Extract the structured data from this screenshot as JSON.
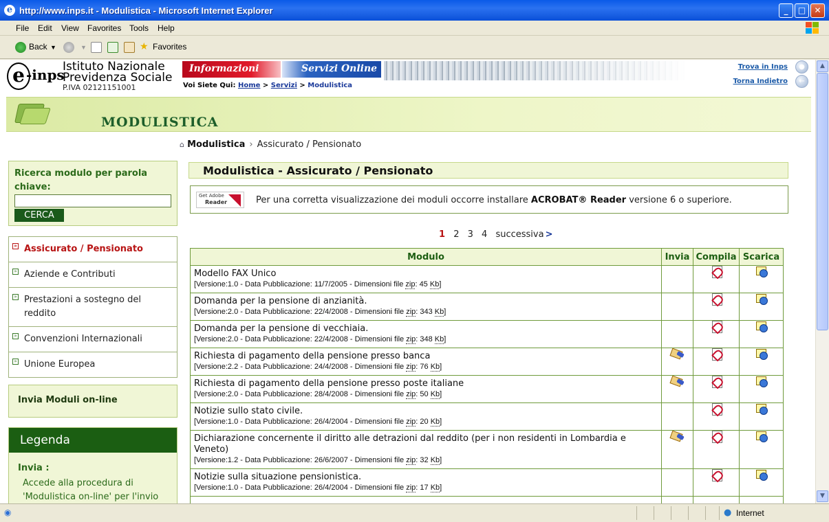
{
  "window": {
    "title": "http://www.inps.it - Modulistica - Microsoft Internet Explorer",
    "minimize": "_",
    "maximize": "□",
    "close": "✕"
  },
  "menu": [
    "File",
    "Edit",
    "View",
    "Favorites",
    "Tools",
    "Help"
  ],
  "toolbar": {
    "back_label": "Back",
    "favorites_label": "Favorites"
  },
  "status": {
    "zone": "Internet"
  },
  "header": {
    "logo_e": "e",
    "logo_inps": "-inps",
    "institute_line1": "Istituto Nazionale",
    "institute_line2": "Previdenza Sociale",
    "piva": "P.IVA 02121151001",
    "tab_informazioni": "Informazioni",
    "tab_servizi": "Servizi Online",
    "you_are_here": "Voi Siete Qui:",
    "crumb_home": "Home",
    "crumb_servizi": "Servizi",
    "crumb_current": "Modulistica",
    "crumb_sep": ">",
    "link_trova": "Trova in Inps",
    "link_torna": "Torna Indietro"
  },
  "banner": {
    "title": "MODULISTICA"
  },
  "page_crumb": {
    "root": "Modulistica",
    "sep": "›",
    "current": "Assicurato / Pensionato"
  },
  "search": {
    "label": "Ricerca modulo per parola chiave:",
    "value": "",
    "button": "CERCA"
  },
  "nav": {
    "items": [
      {
        "label": "Assicurato / Pensionato",
        "active": true
      },
      {
        "label": "Aziende e Contributi",
        "active": false
      },
      {
        "label": "Prestazioni a sostegno del reddito",
        "active": false
      },
      {
        "label": "Convenzioni Internazionali",
        "active": false
      },
      {
        "label": "Unione Europea",
        "active": false
      }
    ]
  },
  "invia_online": "Invia Moduli on-line",
  "legenda": {
    "title": "Legenda",
    "sub": "Invia :",
    "text": "Accede alla procedura di 'Modulistica on-line' per l'invio"
  },
  "main": {
    "title": "Modulistica - Assicurato / Pensionato",
    "adobe_logo_small": "Get Adobe",
    "adobe_logo_big": "Reader",
    "adobe_text_pre": "Per una corretta visualizzazione dei moduli occorre installare",
    "adobe_text_bold": "ACROBAT® Reader",
    "adobe_text_post": "versione 6 o superiore."
  },
  "pager": {
    "pages": [
      "1",
      "2",
      "3",
      "4"
    ],
    "current": "1",
    "next": "successiva",
    "next_arrow": ">"
  },
  "table": {
    "headers": [
      "Modulo",
      "Invia",
      "Compila",
      "Scarica"
    ],
    "rows": [
      {
        "title": "Modello FAX Unico",
        "versione": "1.0",
        "data": "11/7/2005",
        "size": "45",
        "invia": false
      },
      {
        "title": "Domanda per la pensione di anzianità.",
        "versione": "2.0",
        "data": "22/4/2008",
        "size": "343",
        "invia": false
      },
      {
        "title": "Domanda per la pensione di vecchiaia.",
        "versione": "2.0",
        "data": "22/4/2008",
        "size": "348",
        "invia": false
      },
      {
        "title": "Richiesta di pagamento della pensione presso banca",
        "versione": "2.2",
        "data": "24/4/2008",
        "size": "76",
        "invia": true
      },
      {
        "title": "Richiesta di pagamento della pensione presso poste italiane",
        "versione": "2.0",
        "data": "28/4/2008",
        "size": "50",
        "invia": true
      },
      {
        "title": "Notizie sullo stato civile.",
        "versione": "1.0",
        "data": "26/4/2004",
        "size": "20",
        "invia": false
      },
      {
        "title": "Dichiarazione concernente il diritto alle detrazioni dal reddito (per i non residenti in Lombardia e Veneto)",
        "versione": "1.2",
        "data": "26/6/2007",
        "size": "32",
        "invia": true
      },
      {
        "title": "Notizie sulla situazione pensionistica.",
        "versione": "1.0",
        "data": "26/4/2004",
        "size": "17",
        "invia": false
      }
    ],
    "meta_labels": {
      "versione": "[Versione:",
      "data": " - Data Pubblicazione: ",
      "dim": " - Dimensioni file ",
      "zip": "zip",
      "kb": "Kb",
      "close": "]"
    }
  }
}
